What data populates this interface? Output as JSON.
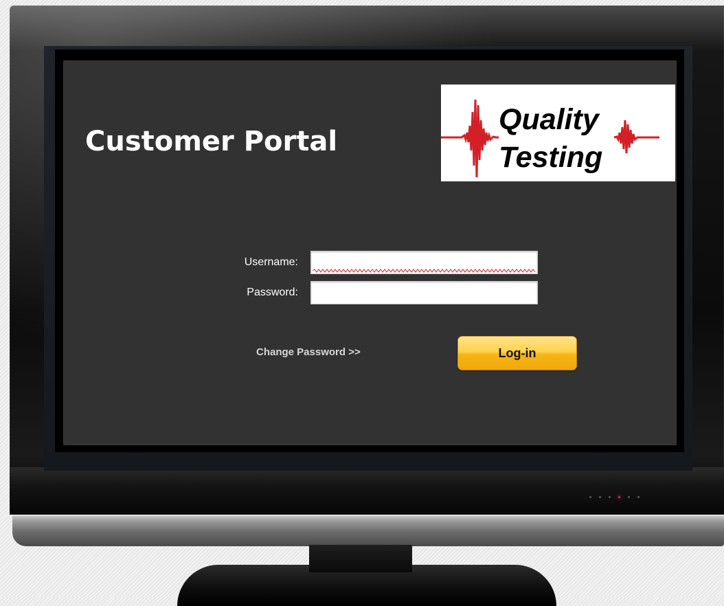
{
  "portal": {
    "title": "Customer Portal"
  },
  "logo": {
    "line1": "Quality",
    "line2": "Testing",
    "wave_color": "#d32026",
    "background": "#ffffff"
  },
  "form": {
    "username_label": "Username:",
    "username_value": "",
    "password_label": "Password:",
    "password_value": "",
    "change_password_link": "Change Password >>",
    "login_button": "Log-in"
  },
  "colors": {
    "screen_background": "#323232",
    "button_accent": "#ffc52b",
    "link_text": "#d6d6d6",
    "spellcheck_underline": "#d32026"
  },
  "icons": {
    "logo_wave": "seismic-wave-icon",
    "power_led": "power-led-icon"
  }
}
